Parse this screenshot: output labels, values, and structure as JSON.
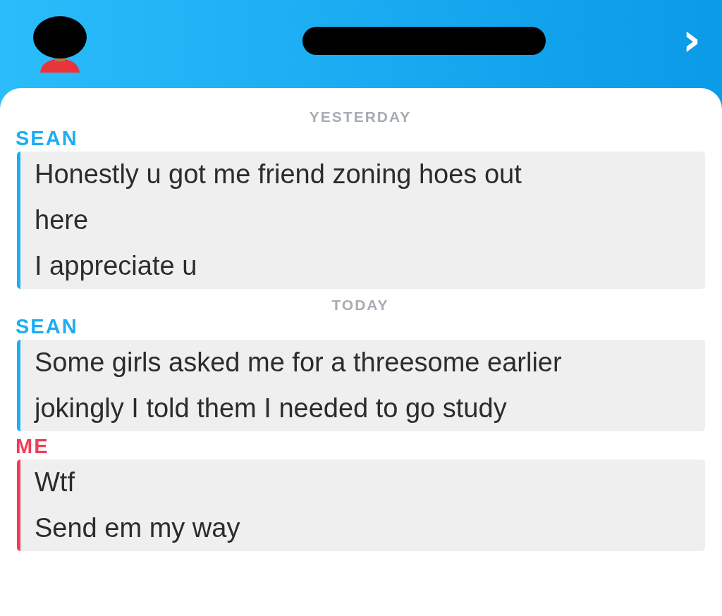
{
  "header": {
    "chevron": "›"
  },
  "groups": [
    {
      "date": "YESTERDAY",
      "messages": [
        {
          "sender": "SEAN",
          "kind": "friend",
          "lines": [
            "Honestly u got me friend zoning hoes out",
            "here",
            "I appreciate u"
          ]
        }
      ]
    },
    {
      "date": "TODAY",
      "messages": [
        {
          "sender": "SEAN",
          "kind": "friend",
          "lines": [
            "Some girls asked me for a threesome earlier",
            "jokingly I told them I needed to go study"
          ]
        },
        {
          "sender": "ME",
          "kind": "self",
          "lines": [
            "Wtf",
            "Send em my way"
          ]
        }
      ]
    }
  ]
}
